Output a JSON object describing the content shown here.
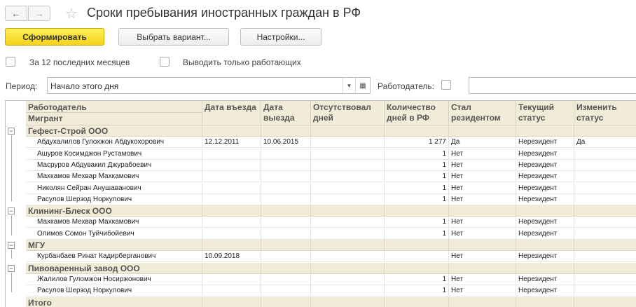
{
  "window": {
    "title": "Сроки пребывания иностранных граждан в РФ",
    "back_icon": "←",
    "forward_icon": "→",
    "favorite_icon": "☆"
  },
  "toolbar": {
    "generate_label": "Сформировать",
    "variant_label": "Выбрать вариант...",
    "settings_label": "Настройки..."
  },
  "filters": {
    "last12_label": "За 12 последних месяцев",
    "only_working_label": "Выводить только работающих",
    "period_label": "Период:",
    "period_value": "Начало этого дня",
    "employer_label": "Работодатель:",
    "dropdown_icon": "▼",
    "calendar_icon": "▦"
  },
  "table": {
    "headers": {
      "employer": "Работодатель",
      "migrant": "Мигрант",
      "entry": "Дата въезда",
      "exit": "Дата выезда",
      "absent": "Отсутствовал дней",
      "days": "Количество дней в РФ",
      "resident": "Стал резидентом",
      "status": "Текущий статус",
      "change": "Изменить статус"
    },
    "groups": [
      {
        "name": "Гефест-Строй ООО",
        "rows": [
          {
            "name": "Абдухалилов Гулохжон Абдукохорович",
            "entry": "12.12.2011",
            "exit": "10.06.2015",
            "absent": "",
            "days": "1 277",
            "resident": "Да",
            "status": "Нерезидент",
            "change": "Да"
          },
          {
            "name": "Ашуров Косимджон Рустамович",
            "entry": "",
            "exit": "",
            "absent": "",
            "days": "1",
            "resident": "Нет",
            "status": "Нерезидент",
            "change": ""
          },
          {
            "name": "Масруров Абдувакил Джурабоевич",
            "entry": "",
            "exit": "",
            "absent": "",
            "days": "1",
            "resident": "Нет",
            "status": "Нерезидент",
            "change": ""
          },
          {
            "name": "Махкамов Мехвар Махкамович",
            "entry": "",
            "exit": "",
            "absent": "",
            "days": "1",
            "resident": "Нет",
            "status": "Нерезидент",
            "change": ""
          },
          {
            "name": "Николян Сейран Анушаванович",
            "entry": "",
            "exit": "",
            "absent": "",
            "days": "1",
            "resident": "Нет",
            "status": "Нерезидент",
            "change": ""
          },
          {
            "name": "Расулов Шерзод Норкулович",
            "entry": "",
            "exit": "",
            "absent": "",
            "days": "1",
            "resident": "Нет",
            "status": "Нерезидент",
            "change": ""
          }
        ]
      },
      {
        "name": "Клининг-Блеск ООО",
        "rows": [
          {
            "name": "Махкамов Мехвар Махкамович",
            "entry": "",
            "exit": "",
            "absent": "",
            "days": "1",
            "resident": "Нет",
            "status": "Нерезидент",
            "change": ""
          },
          {
            "name": "Олимов Сомон Туйчибойевич",
            "entry": "",
            "exit": "",
            "absent": "",
            "days": "1",
            "resident": "Нет",
            "status": "Нерезидент",
            "change": ""
          }
        ]
      },
      {
        "name": "МГУ",
        "rows": [
          {
            "name": "Курбанбаев Ринат Кадирберганович",
            "entry": "10.09.2018",
            "exit": "",
            "absent": "",
            "days": "",
            "resident": "Нет",
            "status": "Нерезидент",
            "change": ""
          }
        ]
      },
      {
        "name": "Пивоваренный завод ООО",
        "rows": [
          {
            "name": "Жалилов Гуломжон Носиржонович",
            "entry": "",
            "exit": "",
            "absent": "",
            "days": "1",
            "resident": "Нет",
            "status": "Нерезидент",
            "change": ""
          },
          {
            "name": "Расулов Шерзод Норкулович",
            "entry": "",
            "exit": "",
            "absent": "",
            "days": "1",
            "resident": "Нет",
            "status": "Нерезидент",
            "change": ""
          }
        ]
      }
    ],
    "total_label": "Итого",
    "collapse_icon": "−"
  }
}
